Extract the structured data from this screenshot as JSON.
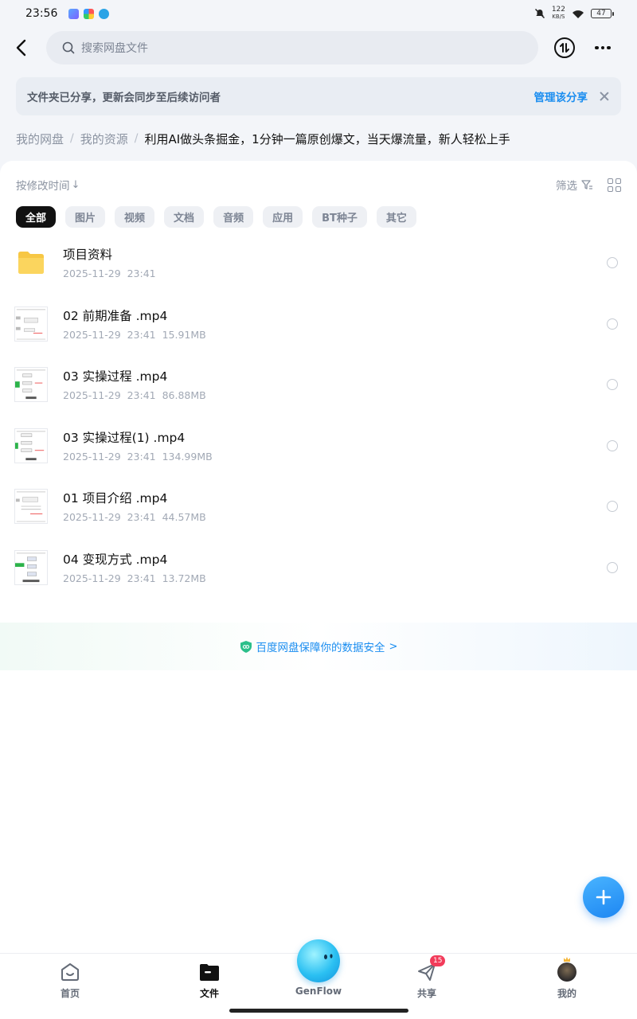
{
  "status_bar": {
    "time": "23:56",
    "net_speed_value": "122",
    "net_speed_unit": "KB/S",
    "battery": "47"
  },
  "header": {
    "search_placeholder": "搜索网盘文件"
  },
  "share_banner": {
    "text": "文件夹已分享，更新会同步至后续访问者",
    "manage_label": "管理该分享"
  },
  "breadcrumb": {
    "items": [
      "我的网盘",
      "我的资源"
    ],
    "current": "利用AI做头条掘金，1分钟一篇原创爆文，当天爆流量，新人轻松上手"
  },
  "toolbar": {
    "sort_label": "按修改时间",
    "sort_arrow": "↓",
    "filter_label": "筛选"
  },
  "chips": [
    "全部",
    "图片",
    "视频",
    "文档",
    "音频",
    "应用",
    "BT种子",
    "其它"
  ],
  "files": [
    {
      "name": "项目资料",
      "date": "2025-11-29",
      "time": "23:41",
      "size": "",
      "type": "folder"
    },
    {
      "name": "02 前期准备 .mp4",
      "date": "2025-11-29",
      "time": "23:41",
      "size": "15.91MB",
      "type": "video"
    },
    {
      "name": "03 实操过程 .mp4",
      "date": "2025-11-29",
      "time": "23:41",
      "size": "86.88MB",
      "type": "video"
    },
    {
      "name": "03 实操过程(1) .mp4",
      "date": "2025-11-29",
      "time": "23:41",
      "size": "134.99MB",
      "type": "video"
    },
    {
      "name": "01 项目介绍 .mp4",
      "date": "2025-11-29",
      "time": "23:41",
      "size": "44.57MB",
      "type": "video"
    },
    {
      "name": "04 变现方式 .mp4",
      "date": "2025-11-29",
      "time": "23:41",
      "size": "13.72MB",
      "type": "video"
    }
  ],
  "safety": {
    "text": "百度网盘保障你的数据安全",
    "chevron": ">"
  },
  "bottom_nav": {
    "home": "首页",
    "files": "文件",
    "genflow": "GenFlow",
    "share": "共享",
    "share_badge": "15",
    "mine": "我的"
  },
  "colors": {
    "accent": "#1a8df0",
    "badge": "#f23b5a",
    "folder": "#f7c744"
  }
}
